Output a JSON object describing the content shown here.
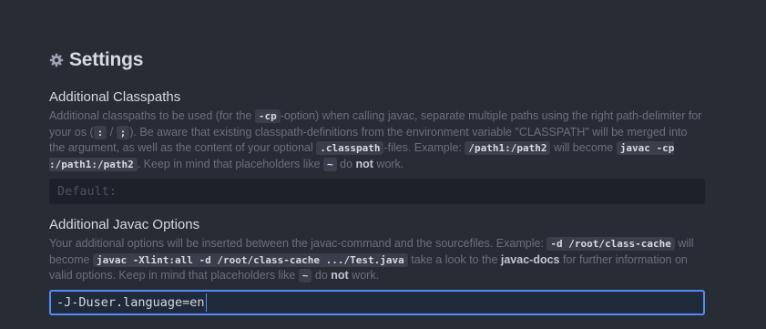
{
  "header": {
    "title": "Settings",
    "icon": "gear-icon"
  },
  "classpaths": {
    "title": "Additional Classpaths",
    "d1": "Additional classpaths to be used (for the ",
    "c1": "-cp",
    "d2": "-option) when calling javac, separate multiple paths using the right path-delimiter for your os (",
    "c2": ":",
    "d3": " / ",
    "c3": ";",
    "d4": "). Be aware that existing classpath-definitions from the environment variable \"CLASSPATH\" will be merged into the argument, as well as the content of your optional ",
    "c4": ".classpath",
    "d5": "-files. Example: ",
    "c5": "/path1:/path2",
    "d6": " will become ",
    "c6": "javac -cp :/path1:/path2",
    "d7": ". Keep in mind that placeholders like ",
    "c7": "~",
    "d8": " do ",
    "s1": "not",
    "d9": " work.",
    "placeholder": "Default:"
  },
  "javac_options": {
    "title": "Additional Javac Options",
    "d1": "Your additional options will be inserted between the javac-command and the sourcefiles. Example: ",
    "c1": "-d /root/class-cache",
    "d2": " will become ",
    "c2": "javac -Xlint:all -d /root/class-cache .../Test.java",
    "d3": " take a look to the ",
    "link": "javac-docs",
    "d4": " for further information on valid options. Keep in mind that placeholders like ",
    "c3": "~",
    "d5": " do ",
    "s1": "not",
    "d6": " work.",
    "value": "-J-Duser.language=en"
  },
  "colors": {
    "background": "#282c34",
    "focus_border": "#568af2"
  }
}
